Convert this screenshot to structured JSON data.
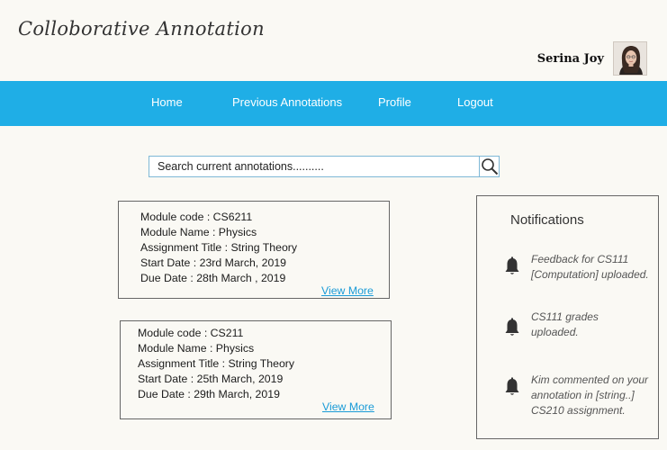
{
  "app": {
    "title": "Colloborative Annotation"
  },
  "user": {
    "name": "Serina Joy"
  },
  "nav": {
    "items": [
      {
        "label": "Home"
      },
      {
        "label": "Previous Annotations"
      },
      {
        "label": "Profile"
      },
      {
        "label": "Logout"
      }
    ]
  },
  "search": {
    "placeholder": "Search current annotations.........."
  },
  "cards": [
    {
      "module_code": "Module code : CS6211",
      "module_name": "Module Name :  Physics",
      "assignment_title": "Assignment Title : String Theory",
      "start_date": "Start Date : 23rd March, 2019",
      "due_date": "Due Date : 28th March , 2019",
      "view_more": "View More"
    },
    {
      "module_code": "Module code : CS211",
      "module_name": "Module Name : Physics",
      "assignment_title": "Assignment Title : String Theory",
      "start_date": "Start Date : 25th March, 2019",
      "due_date": "Due Date : 29th March, 2019",
      "view_more": "View More"
    }
  ],
  "notifications": {
    "title": "Notifications",
    "items": [
      {
        "icon": "bell-icon",
        "line1": "Feedback for CS111",
        "line2": "[Computation] uploaded.",
        "line3": ""
      },
      {
        "icon": "bell-icon",
        "line1": "CS111 grades",
        "line2": "uploaded.",
        "line3": ""
      },
      {
        "icon": "bell-icon",
        "line1": "Kim commented on your",
        "line2": "annotation in [string..]",
        "line3": "CS210 assignment."
      }
    ]
  },
  "colors": {
    "navbar": "#1faee6",
    "link": "#1a9bd7",
    "background": "#faf9f4"
  }
}
